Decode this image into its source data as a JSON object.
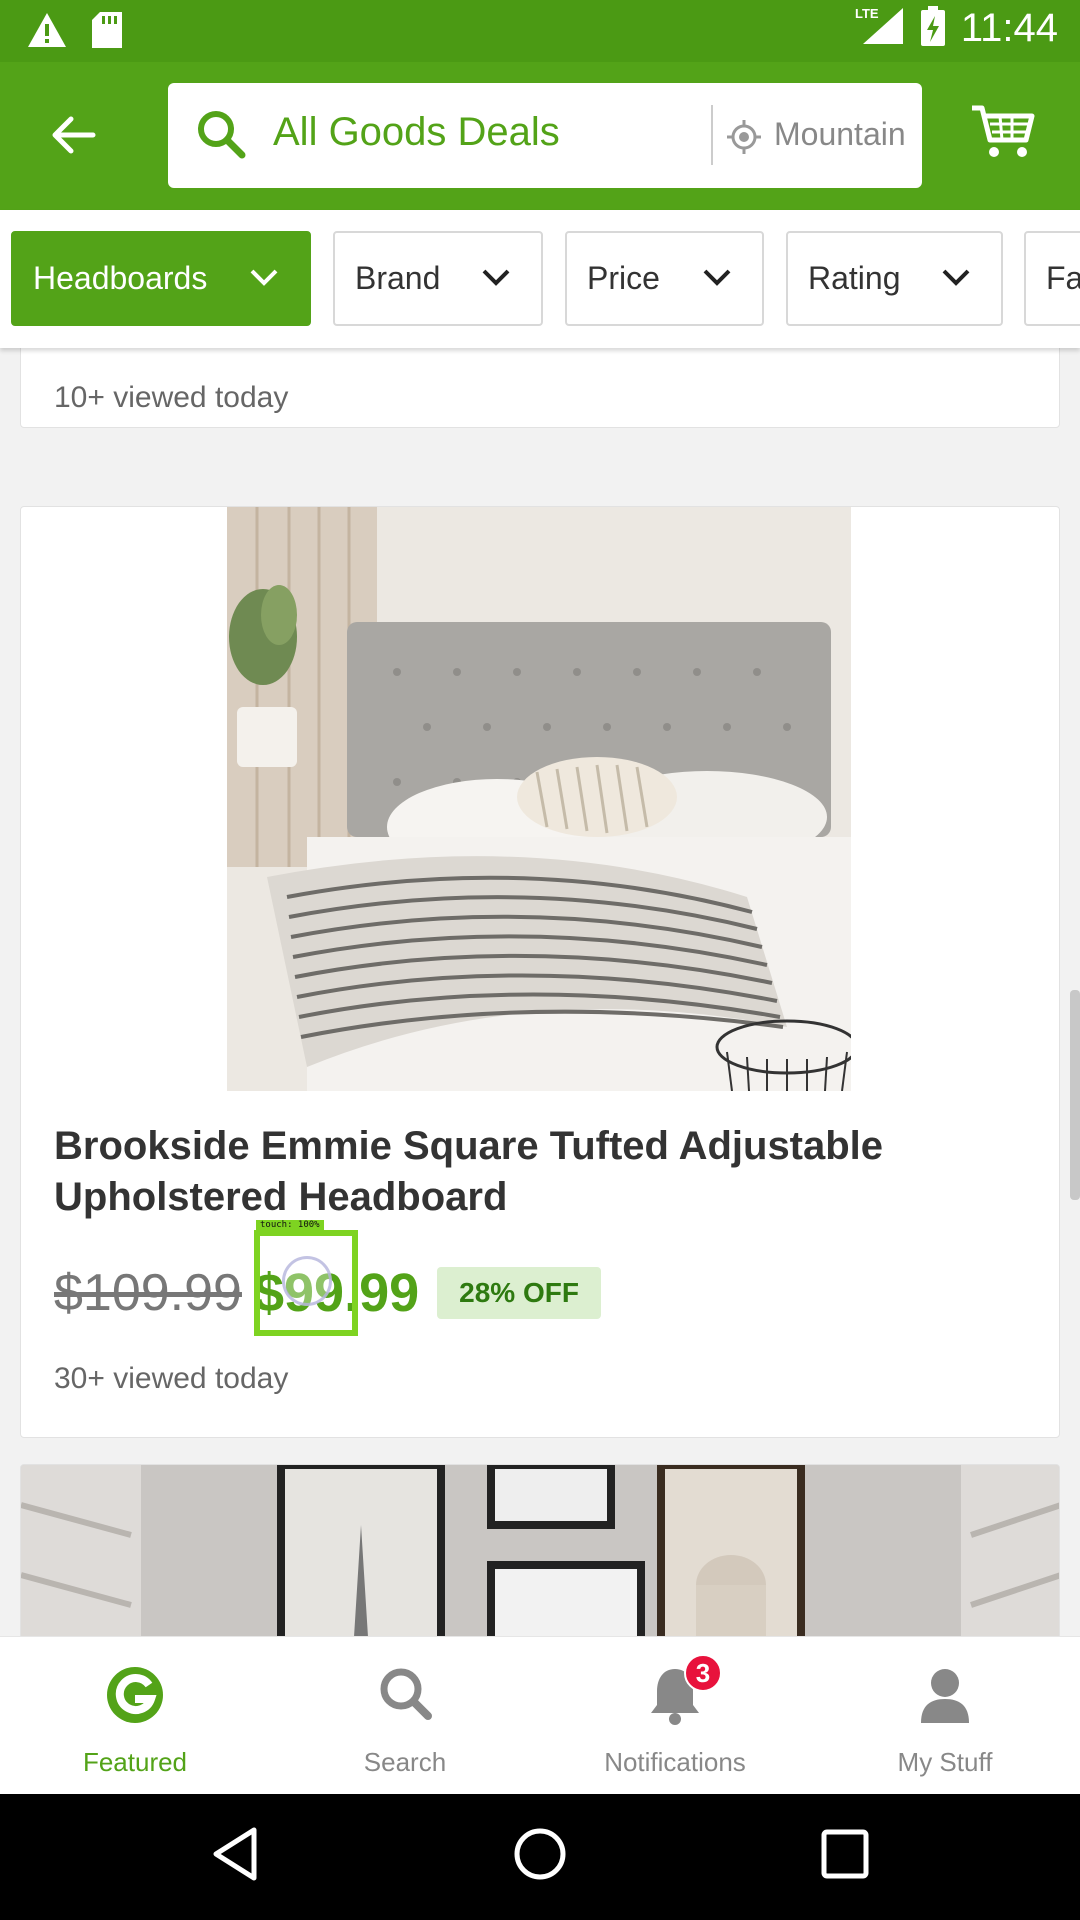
{
  "status_bar": {
    "time": "11:44",
    "network": "LTE",
    "icons": [
      "warning-icon",
      "sd-card-icon",
      "signal-icon",
      "battery-charging-icon"
    ]
  },
  "app_bar": {
    "search_text": "All Goods Deals",
    "location_text": "Mountain",
    "icons": [
      "back-arrow-icon",
      "search-icon",
      "location-target-icon",
      "cart-icon"
    ]
  },
  "filters": [
    {
      "label": "Headboards",
      "active": true
    },
    {
      "label": "Brand",
      "active": false
    },
    {
      "label": "Price",
      "active": false
    },
    {
      "label": "Rating",
      "active": false
    },
    {
      "label": "Fa",
      "active": false
    }
  ],
  "cards": {
    "previous": {
      "viewed": "10+ viewed today"
    },
    "main": {
      "title": "Brookside Emmie Square Tufted Adjustable Upholstered Headboard",
      "old_price": "$109.99",
      "new_price": "$99.99",
      "discount": "28% OFF",
      "viewed": "30+ viewed today"
    }
  },
  "touch_overlay": {
    "label": "touch: 100%"
  },
  "bottom_nav": {
    "items": [
      {
        "label": "Featured",
        "icon": "groupon-g-icon",
        "active": true
      },
      {
        "label": "Search",
        "icon": "search-icon",
        "active": false
      },
      {
        "label": "Notifications",
        "icon": "bell-icon",
        "active": false
      },
      {
        "label": "My Stuff",
        "icon": "person-icon",
        "active": false
      }
    ],
    "notification_count": "3"
  },
  "colors": {
    "brand_green": "#53a318",
    "status_green": "#4b9a14",
    "badge_red": "#e8123c"
  }
}
